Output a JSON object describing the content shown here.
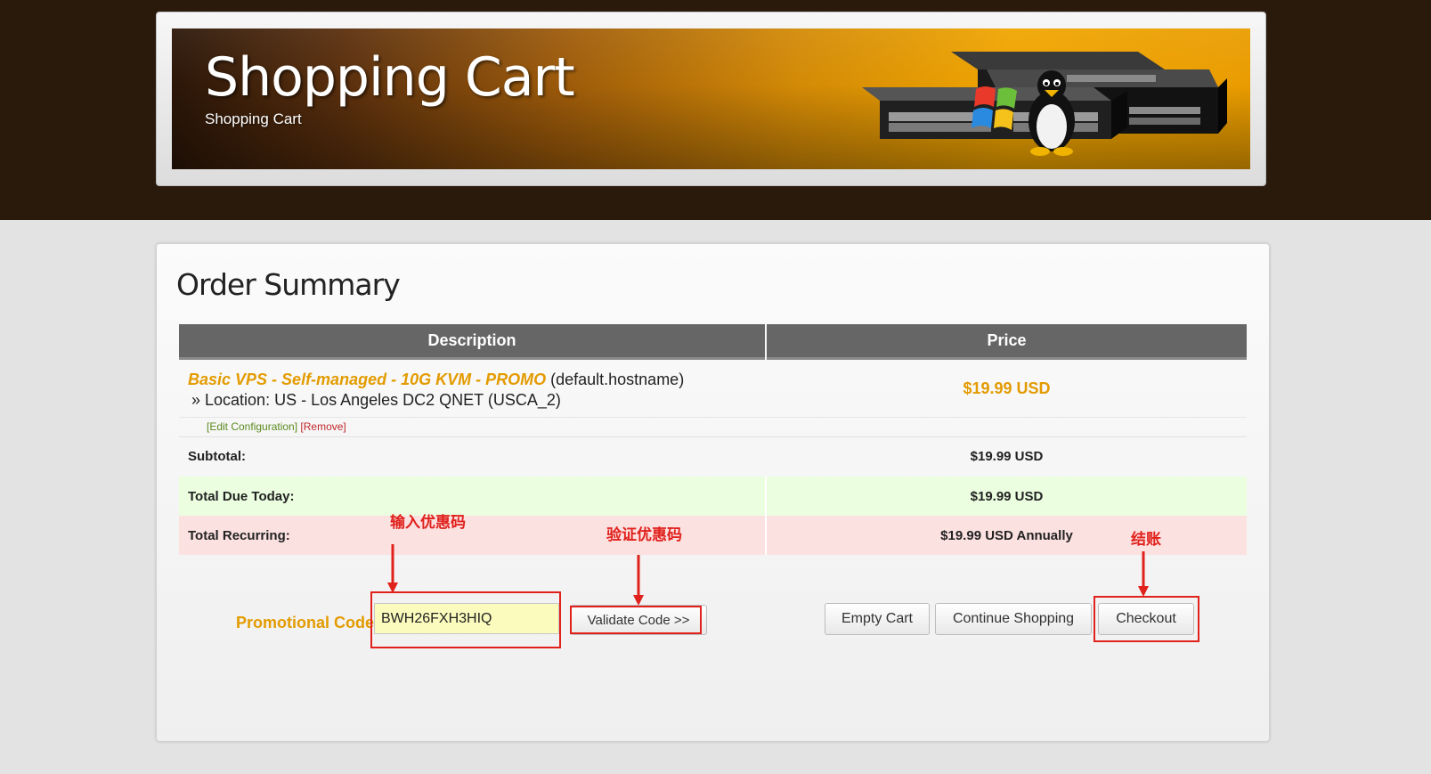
{
  "header": {
    "title": "Shopping Cart",
    "subtitle": "Shopping Cart",
    "art_icons": [
      "network-switch-icon",
      "windows-logo-icon",
      "linux-penguin-icon"
    ]
  },
  "order": {
    "title": "Order Summary",
    "columns": {
      "description": "Description",
      "price": "Price"
    },
    "item": {
      "name": "Basic VPS - Self-managed - 10G KVM - PROMO",
      "hostname": "(default.hostname)",
      "location": "» Location: US - Los Angeles DC2 QNET (USCA_2)",
      "price": "$19.99 USD",
      "edit_label": "[Edit Configuration]",
      "remove_label": "[Remove]"
    },
    "subtotal": {
      "label": "Subtotal:",
      "value": "$19.99 USD"
    },
    "total_due_today": {
      "label": "Total Due Today:",
      "value": "$19.99 USD"
    },
    "total_recurring": {
      "label": "Total Recurring:",
      "value": "$19.99 USD Annually"
    }
  },
  "promo": {
    "label": "Promotional Code",
    "value": "BWH26FXH3HIQ",
    "validate_button": "Validate Code >>"
  },
  "buttons": {
    "empty_cart": "Empty Cart",
    "continue_shopping": "Continue Shopping",
    "checkout": "Checkout"
  },
  "annotations": {
    "enter_code": "输入优惠码",
    "validate_code": "验证优惠码",
    "checkout": "结账"
  },
  "colors": {
    "accent": "#e39b00",
    "annotation": "#e0211c",
    "header_dark": "#2a1a0c",
    "table_head": "#666666",
    "row_today": "#ebffe0",
    "row_recurring": "#fce1e1",
    "promo_input_bg": "#fbfbbd"
  }
}
